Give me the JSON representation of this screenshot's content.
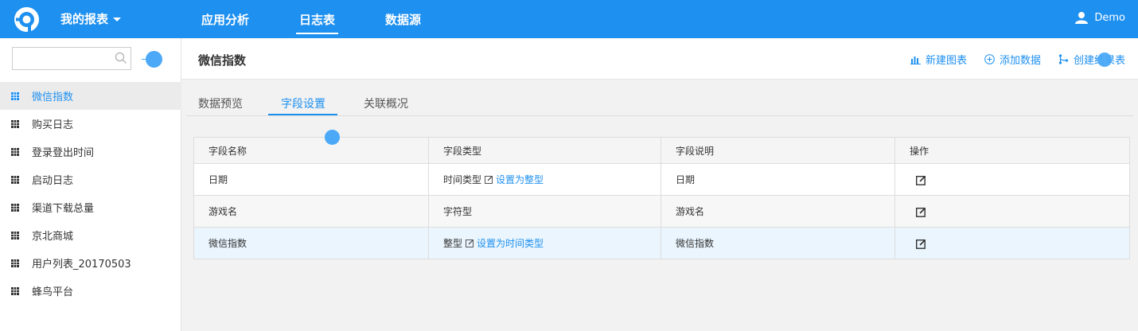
{
  "topbar": {
    "report_menu": "我的报表",
    "nav": [
      "应用分析",
      "日志表",
      "数据源"
    ],
    "active_nav": "日志表",
    "user": "Demo"
  },
  "sidebar": {
    "search_placeholder": "",
    "items": [
      "微信指数",
      "购买日志",
      "登录登出时间",
      "启动日志",
      "渠道下载总量",
      "京北商城",
      "用户列表_20170503",
      "蜂鸟平台"
    ],
    "active_item": "微信指数"
  },
  "header": {
    "title": "微信指数",
    "actions": [
      "新建图表",
      "添加数据",
      "创建结果表"
    ]
  },
  "tabs": [
    "数据预览",
    "字段设置",
    "关联概况"
  ],
  "active_tab": "字段设置",
  "table": {
    "columns": [
      "字段名称",
      "字段类型",
      "字段说明",
      "操作"
    ],
    "rows": [
      {
        "name": "日期",
        "type": "时间类型",
        "convert": "设置为整型",
        "desc": "日期"
      },
      {
        "name": "游戏名",
        "type": "字符型",
        "convert": "",
        "desc": "游戏名"
      },
      {
        "name": "微信指数",
        "type": "整型",
        "convert": "设置为时间类型",
        "desc": "微信指数"
      }
    ]
  },
  "colors": {
    "primary": "#1e90f0",
    "highlight_row": "#eaf5fd",
    "sidebar_active": "#ebebeb"
  }
}
